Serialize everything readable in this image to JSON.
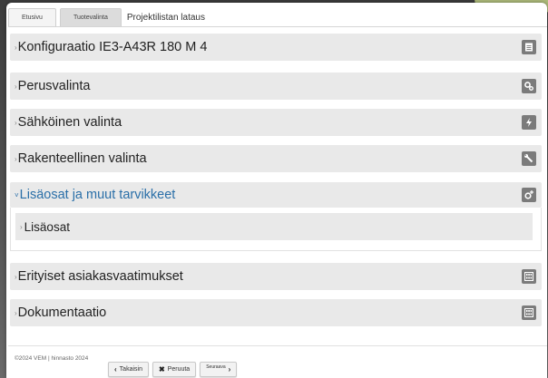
{
  "tabs": {
    "home": "Etusivu",
    "product": "Tuotevalinta",
    "project_load": "Projektilistan lataus"
  },
  "sections": {
    "config": {
      "arrow": "›",
      "label": "Konfiguraatio IE3-A43R 180 M 4",
      "icon": "document-icon"
    },
    "basic": {
      "arrow": "›",
      "label": "Perusvalinta",
      "icon": "gears-icon"
    },
    "electric": {
      "arrow": "›",
      "label": "Sähköinen valinta",
      "icon": "lightning-icon"
    },
    "structural": {
      "arrow": "›",
      "label": "Rakenteellinen valinta",
      "icon": "wrench-icon"
    },
    "accessories": {
      "arrow": "˅",
      "label": "Lisäosat ja muut tarvikkeet",
      "icon": "gear-plus-icon"
    },
    "accessories_sub": {
      "arrow": "›",
      "label": "Lisäosat"
    },
    "special": {
      "arrow": "›",
      "label": "Erityiset asiakasvaatimukset",
      "icon": "calculator-icon"
    },
    "docs": {
      "arrow": "›",
      "label": "Dokumentaatio",
      "icon": "calculator-icon"
    }
  },
  "footer": {
    "copyright": "©2024 VEM | hinnasto 2024",
    "back_label": "Takaisin",
    "back_icon": "‹",
    "cancel_label": "Peruuta",
    "cancel_icon": "✖",
    "next_label": "Seuraava",
    "next_icon": "›"
  },
  "colors": {
    "section_bg": "#e9e9e9",
    "open_label": "#2a6fa8",
    "icon_bg": "#7b7b7b"
  }
}
